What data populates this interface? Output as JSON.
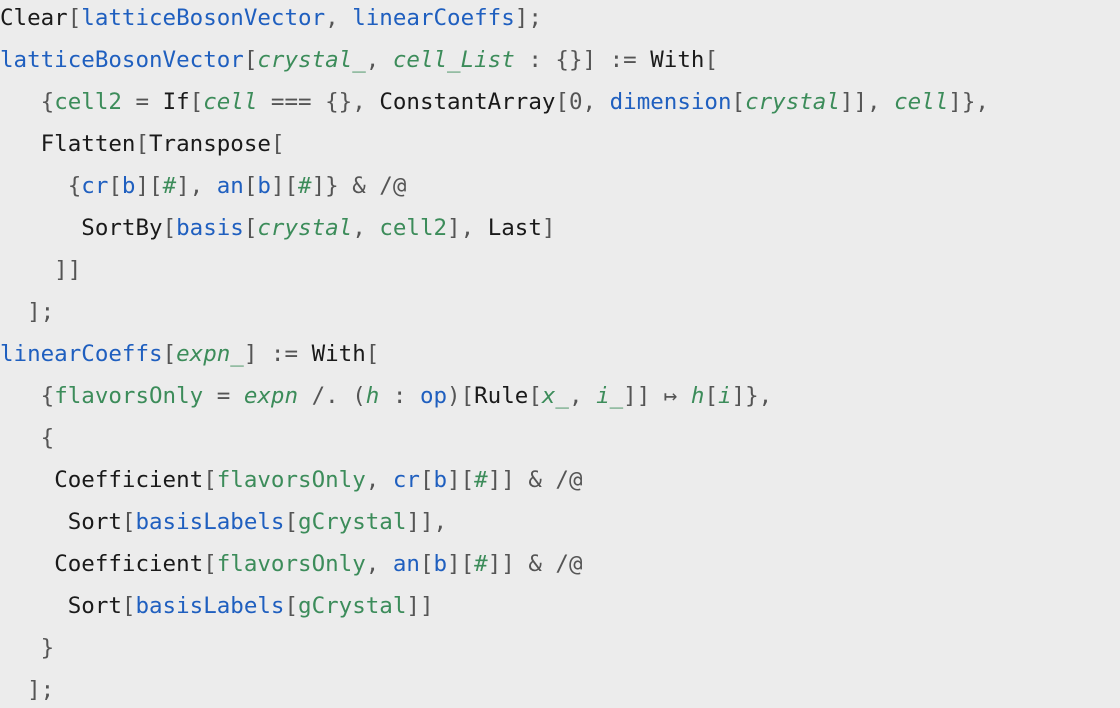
{
  "code_lines": [
    [
      [
        "Clear",
        "k"
      ],
      [
        "[",
        "p"
      ],
      [
        "latticeBosonVector",
        "s"
      ],
      [
        ", ",
        "p"
      ],
      [
        "linearCoeffs",
        "s"
      ],
      [
        "];",
        "p"
      ]
    ],
    [
      [
        "latticeBosonVector",
        "s"
      ],
      [
        "[",
        "p"
      ],
      [
        "crystal_",
        "vi"
      ],
      [
        ", ",
        "p"
      ],
      [
        "cell_List",
        "vi"
      ],
      [
        " : {}] := ",
        "p"
      ],
      [
        "With",
        "k"
      ],
      [
        "[",
        "p"
      ]
    ],
    [
      [
        "   {",
        "p"
      ],
      [
        "cell2",
        "v"
      ],
      [
        " = ",
        "p"
      ],
      [
        "If",
        "k"
      ],
      [
        "[",
        "p"
      ],
      [
        "cell",
        "vi"
      ],
      [
        " === {}, ",
        "p"
      ],
      [
        "ConstantArray",
        "k"
      ],
      [
        "[0, ",
        "p"
      ],
      [
        "dimension",
        "s"
      ],
      [
        "[",
        "p"
      ],
      [
        "crystal",
        "vi"
      ],
      [
        "]], ",
        "p"
      ],
      [
        "cell",
        "vi"
      ],
      [
        "]},",
        "p"
      ]
    ],
    [
      [
        "   ",
        "p"
      ],
      [
        "Flatten",
        "k"
      ],
      [
        "[",
        "p"
      ],
      [
        "Transpose",
        "k"
      ],
      [
        "[",
        "p"
      ]
    ],
    [
      [
        "     {",
        "p"
      ],
      [
        "cr",
        "s"
      ],
      [
        "[",
        "p"
      ],
      [
        "b",
        "s"
      ],
      [
        "][",
        "p"
      ],
      [
        "#",
        "v"
      ],
      [
        "], ",
        "p"
      ],
      [
        "an",
        "s"
      ],
      [
        "[",
        "p"
      ],
      [
        "b",
        "s"
      ],
      [
        "][",
        "p"
      ],
      [
        "#",
        "v"
      ],
      [
        "]} & /@",
        "p"
      ]
    ],
    [
      [
        "      ",
        "p"
      ],
      [
        "SortBy",
        "k"
      ],
      [
        "[",
        "p"
      ],
      [
        "basis",
        "s"
      ],
      [
        "[",
        "p"
      ],
      [
        "crystal",
        "vi"
      ],
      [
        ", ",
        "p"
      ],
      [
        "cell2",
        "v"
      ],
      [
        "], ",
        "p"
      ],
      [
        "Last",
        "k"
      ],
      [
        "]",
        "p"
      ]
    ],
    [
      [
        "    ]]",
        "p"
      ]
    ],
    [
      [
        "  ];",
        "p"
      ]
    ],
    [
      [
        "linearCoeffs",
        "s"
      ],
      [
        "[",
        "p"
      ],
      [
        "expn_",
        "vi"
      ],
      [
        "] := ",
        "p"
      ],
      [
        "With",
        "k"
      ],
      [
        "[",
        "p"
      ]
    ],
    [
      [
        "   {",
        "p"
      ],
      [
        "flavorsOnly",
        "v"
      ],
      [
        " = ",
        "p"
      ],
      [
        "expn",
        "vi"
      ],
      [
        " /. (",
        "p"
      ],
      [
        "h",
        "vi"
      ],
      [
        " : ",
        "p"
      ],
      [
        "op",
        "s"
      ],
      [
        ")[",
        "p"
      ],
      [
        "Rule",
        "k"
      ],
      [
        "[",
        "p"
      ],
      [
        "x_",
        "vi"
      ],
      [
        ", ",
        "p"
      ],
      [
        "i_",
        "vi"
      ],
      [
        "]] ↦ ",
        "p"
      ],
      [
        "h",
        "vi"
      ],
      [
        "[",
        "p"
      ],
      [
        "i",
        "vi"
      ],
      [
        "]},",
        "p"
      ]
    ],
    [
      [
        "   {",
        "p"
      ]
    ],
    [
      [
        "    ",
        "p"
      ],
      [
        "Coefficient",
        "k"
      ],
      [
        "[",
        "p"
      ],
      [
        "flavorsOnly",
        "v"
      ],
      [
        ", ",
        "p"
      ],
      [
        "cr",
        "s"
      ],
      [
        "[",
        "p"
      ],
      [
        "b",
        "s"
      ],
      [
        "][",
        "p"
      ],
      [
        "#",
        "v"
      ],
      [
        "]] & /@",
        "p"
      ]
    ],
    [
      [
        "     ",
        "p"
      ],
      [
        "Sort",
        "k"
      ],
      [
        "[",
        "p"
      ],
      [
        "basisLabels",
        "s"
      ],
      [
        "[",
        "p"
      ],
      [
        "gCrystal",
        "v"
      ],
      [
        "]],",
        "p"
      ]
    ],
    [
      [
        "    ",
        "p"
      ],
      [
        "Coefficient",
        "k"
      ],
      [
        "[",
        "p"
      ],
      [
        "flavorsOnly",
        "v"
      ],
      [
        ", ",
        "p"
      ],
      [
        "an",
        "s"
      ],
      [
        "[",
        "p"
      ],
      [
        "b",
        "s"
      ],
      [
        "][",
        "p"
      ],
      [
        "#",
        "v"
      ],
      [
        "]] & /@",
        "p"
      ]
    ],
    [
      [
        "     ",
        "p"
      ],
      [
        "Sort",
        "k"
      ],
      [
        "[",
        "p"
      ],
      [
        "basisLabels",
        "s"
      ],
      [
        "[",
        "p"
      ],
      [
        "gCrystal",
        "v"
      ],
      [
        "]]",
        "p"
      ]
    ],
    [
      [
        "   }",
        "p"
      ]
    ],
    [
      [
        "  ];",
        "p"
      ]
    ]
  ],
  "colors": {
    "background": "#ececec",
    "builtin": "#1a1a1a",
    "user_symbol": "#1f5fbf",
    "local_variable": "#3c8c5a",
    "punctuation": "#555555"
  }
}
